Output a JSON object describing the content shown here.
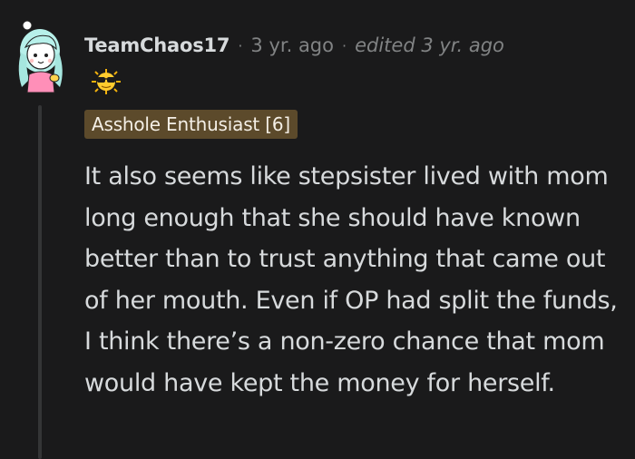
{
  "comment": {
    "author": "TeamChaos17",
    "separator": "·",
    "time": "3 yr. ago",
    "edited": "edited 3 yr. ago",
    "flair": "Asshole Enthusiast [6]",
    "award": "sunglasses-award-icon",
    "text": "It also seems like stepsister lived with mom long enough that she should have known better than to trust anything that came out of her mouth. Even if OP had split the funds, I think there’s a non-zero chance that mom would have kept the money for herself."
  },
  "colors": {
    "background": "#1a1a1b",
    "text": "#d7dadc",
    "muted": "#818384",
    "flair_bg": "#5c4a2b",
    "thread_line": "#343536"
  }
}
